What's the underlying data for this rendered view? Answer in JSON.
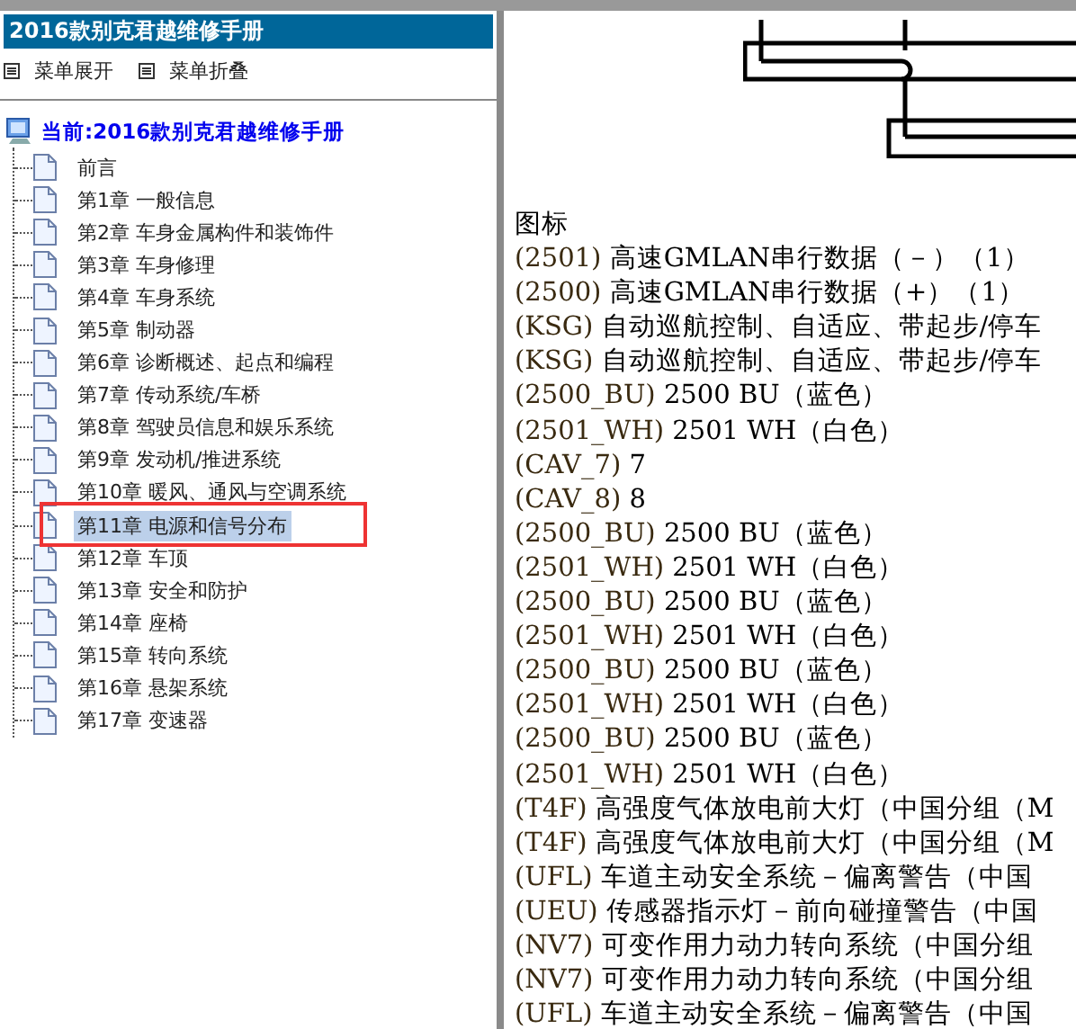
{
  "left_panel": {
    "title": "2016款别克君越维修手册",
    "menu": [
      {
        "label": "菜单展开"
      },
      {
        "label": "菜单折叠"
      }
    ],
    "tree": {
      "label": "当前:2016款别克君越维修手册",
      "children": [
        {
          "label": "前言",
          "selected": false
        },
        {
          "label": "第1章 一般信息",
          "selected": false
        },
        {
          "label": "第2章 车身金属构件和装饰件",
          "selected": false
        },
        {
          "label": "第3章 车身修理",
          "selected": false
        },
        {
          "label": "第4章 车身系统",
          "selected": false
        },
        {
          "label": "第5章 制动器",
          "selected": false
        },
        {
          "label": "第6章 诊断概述、起点和编程",
          "selected": false
        },
        {
          "label": "第7章 传动系统/车桥",
          "selected": false
        },
        {
          "label": "第8章 驾驶员信息和娱乐系统",
          "selected": false
        },
        {
          "label": "第9章 发动机/推进系统",
          "selected": false
        },
        {
          "label": "第10章 暖风、通风与空调系统",
          "selected": false
        },
        {
          "label": "第11章 电源和信号分布",
          "selected": true
        },
        {
          "label": "第12章 车顶",
          "selected": false
        },
        {
          "label": "第13章 安全和防护",
          "selected": false
        },
        {
          "label": "第14章 座椅",
          "selected": false
        },
        {
          "label": "第15章 转向系统",
          "selected": false
        },
        {
          "label": "第16章 悬架系统",
          "selected": false
        },
        {
          "label": "第17章 变速器",
          "selected": false
        }
      ]
    }
  },
  "content": {
    "heading": "图标",
    "legend": [
      {
        "code": "(2501)",
        "text": "高速GMLAN串行数据（－）（1）"
      },
      {
        "code": "(2500)",
        "text": "高速GMLAN串行数据（+）（1）"
      },
      {
        "code": "(KSG)",
        "text": "自动巡航控制、自适应、带起步/停车"
      },
      {
        "code": "(KSG)",
        "text": "自动巡航控制、自适应、带起步/停车"
      },
      {
        "code": "(2500_BU)",
        "text": "2500 BU（蓝色）"
      },
      {
        "code": "(2501_WH)",
        "text": "2501 WH（白色）"
      },
      {
        "code": "(CAV_7)",
        "text": "7"
      },
      {
        "code": "(CAV_8)",
        "text": "8"
      },
      {
        "code": "(2500_BU)",
        "text": "2500 BU（蓝色）"
      },
      {
        "code": "(2501_WH)",
        "text": "2501 WH（白色）"
      },
      {
        "code": "(2500_BU)",
        "text": "2500 BU（蓝色）"
      },
      {
        "code": "(2501_WH)",
        "text": "2501 WH（白色）"
      },
      {
        "code": "(2500_BU)",
        "text": "2500 BU（蓝色）"
      },
      {
        "code": "(2501_WH)",
        "text": "2501 WH（白色）"
      },
      {
        "code": "(2500_BU)",
        "text": "2500 BU（蓝色）"
      },
      {
        "code": "(2501_WH)",
        "text": "2501 WH（白色）"
      },
      {
        "code": "(T4F)",
        "text": "高强度气体放电前大灯（中国分组（M"
      },
      {
        "code": "(T4F)",
        "text": "高强度气体放电前大灯（中国分组（M"
      },
      {
        "code": "(UFL)",
        "text": "车道主动安全系统－偏离警告（中国"
      },
      {
        "code": "(UEU)",
        "text": "传感器指示灯－前向碰撞警告（中国"
      },
      {
        "code": "(NV7)",
        "text": "可变作用力动力转向系统（中国分组"
      },
      {
        "code": "(NV7)",
        "text": "可变作用力动力转向系统（中国分组"
      },
      {
        "code": "(UFL)",
        "text": "车道主动安全系统－偏离警告（中国"
      }
    ]
  }
}
